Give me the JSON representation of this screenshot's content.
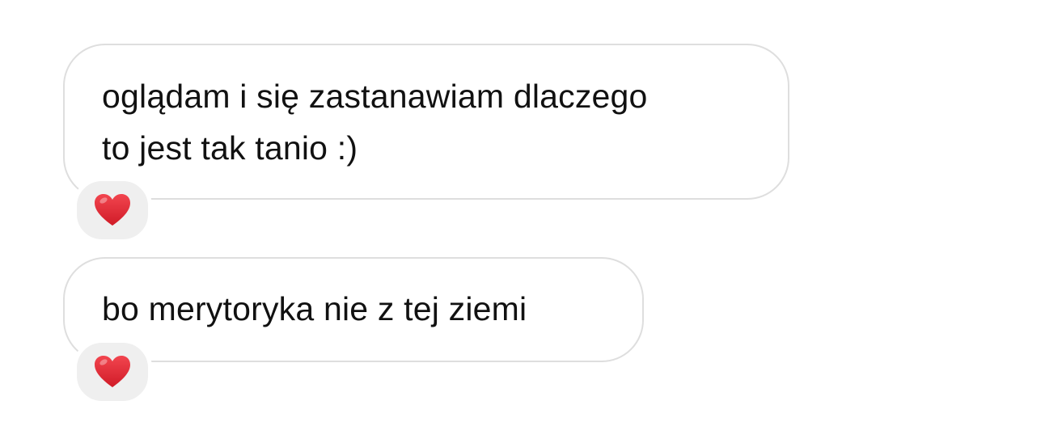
{
  "messages": [
    {
      "lines": [
        "oglądam i się zastanawiam dlaczego",
        "to jest tak tanio :)"
      ],
      "reaction": "heart-icon"
    },
    {
      "lines": [
        "bo merytoryka nie z tej ziemi"
      ],
      "reaction": "heart-icon"
    }
  ],
  "colors": {
    "bubble_border": "#dedede",
    "reaction_background": "#efefef",
    "heart": "#e0242f",
    "text": "#111111"
  }
}
